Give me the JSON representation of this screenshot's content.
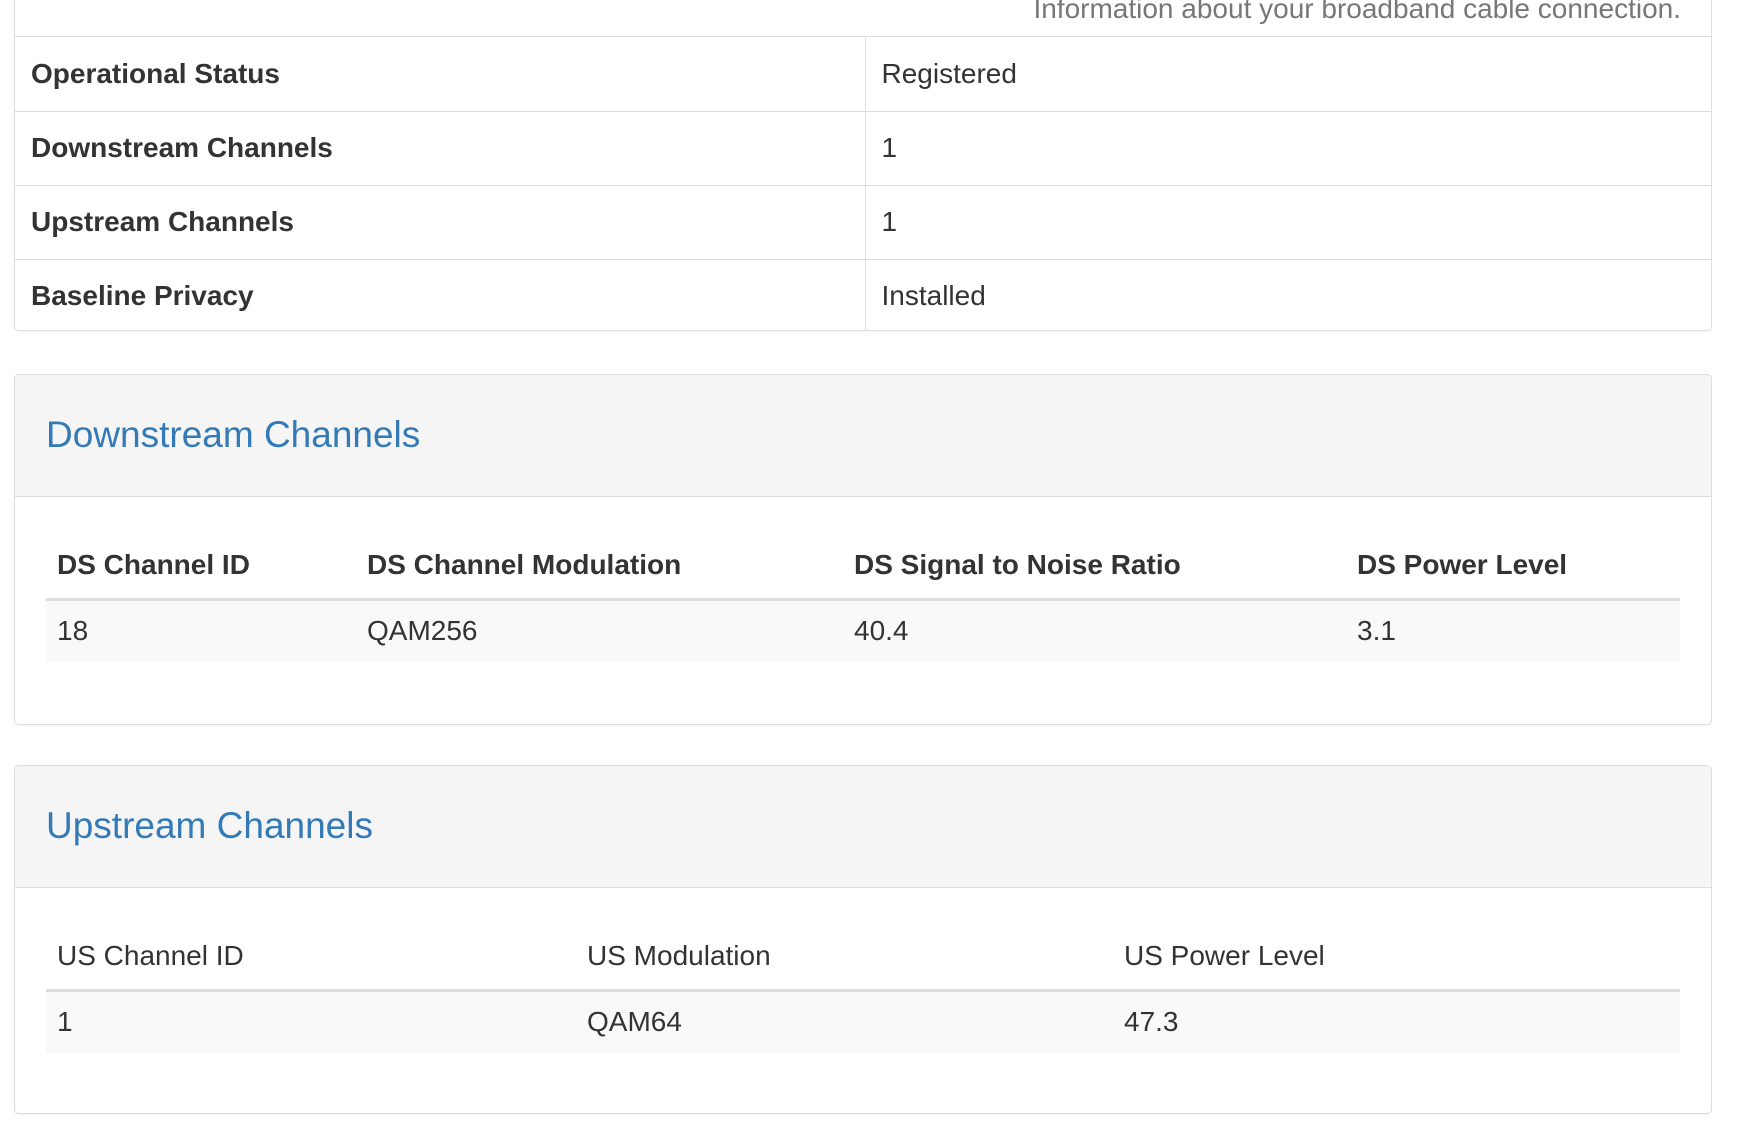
{
  "summary": {
    "description": "Information about your broadband cable connection.",
    "rows": [
      {
        "label": "Operational Status",
        "value": "Registered"
      },
      {
        "label": "Downstream Channels",
        "value": "1"
      },
      {
        "label": "Upstream Channels",
        "value": "1"
      },
      {
        "label": "Baseline Privacy",
        "value": "Installed"
      }
    ]
  },
  "downstream": {
    "title": "Downstream Channels",
    "columns": [
      "DS Channel ID",
      "DS Channel Modulation",
      "DS Signal to Noise Ratio",
      "DS Power Level"
    ],
    "rows": [
      [
        "18",
        "QAM256",
        "40.4",
        "3.1"
      ]
    ]
  },
  "upstream": {
    "title": "Upstream Channels",
    "columns": [
      "US Channel ID",
      "US Modulation",
      "US Power Level"
    ],
    "rows": [
      [
        "1",
        "QAM64",
        "47.3"
      ]
    ]
  },
  "colors": {
    "panel_title": "#337ab7",
    "border": "#dddddd",
    "heading_bg": "#f5f5f5",
    "row_stripe": "#f9f9f9"
  }
}
